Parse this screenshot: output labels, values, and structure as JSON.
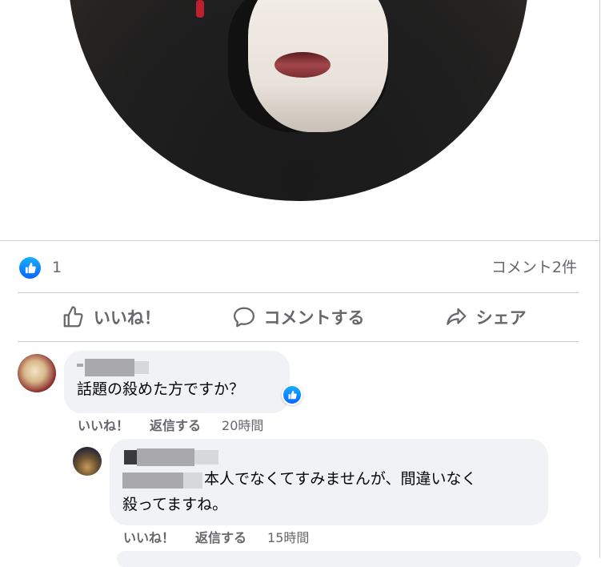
{
  "post": {
    "like_count": "1",
    "comment_count_label": "コメント2件"
  },
  "actions": {
    "like": "いいね！",
    "comment": "コメントする",
    "share": "シェア"
  },
  "comments": [
    {
      "text": "話題の殺めた方ですか？",
      "like_label": "いいね！",
      "reply_label": "返信する",
      "time": "20時間"
    },
    {
      "text_line1": "本人でなくてすみませんが、間違いなく",
      "text_line2": "殺ってますね。",
      "like_label": "いいね！",
      "reply_label": "返信する",
      "time": "15時間"
    }
  ],
  "icons": {
    "like_reaction": "like-reaction-icon",
    "like_action": "thumbs-up-icon",
    "comment_action": "speech-bubble-icon",
    "share_action": "share-arrow-icon"
  },
  "colors": {
    "accent": "#0866ff",
    "secondary_text": "#65676b",
    "bubble": "#f0f2f5"
  }
}
